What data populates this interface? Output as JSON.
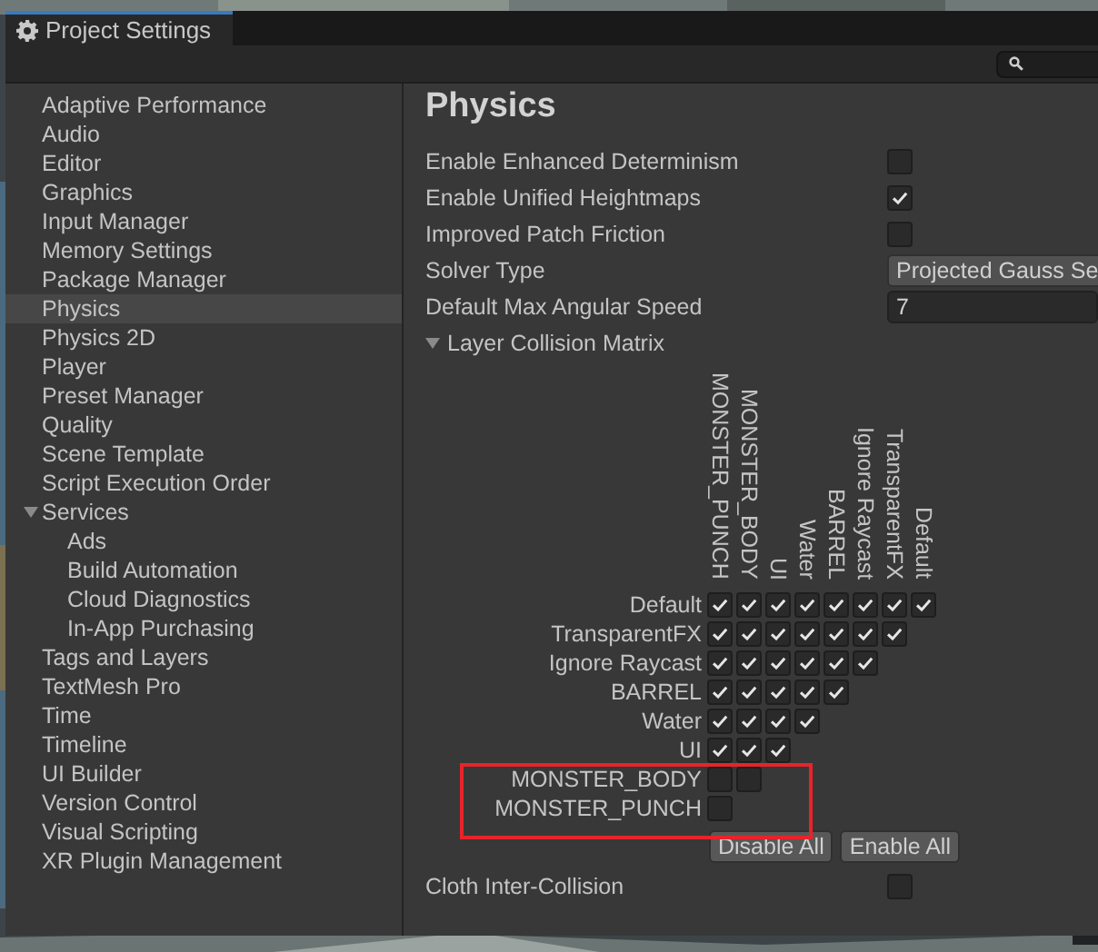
{
  "window": {
    "title": "Project Settings"
  },
  "sidebar": {
    "items": [
      {
        "label": "Adaptive Performance",
        "selected": false
      },
      {
        "label": "Audio",
        "selected": false
      },
      {
        "label": "Editor",
        "selected": false
      },
      {
        "label": "Graphics",
        "selected": false
      },
      {
        "label": "Input Manager",
        "selected": false
      },
      {
        "label": "Memory Settings",
        "selected": false
      },
      {
        "label": "Package Manager",
        "selected": false
      },
      {
        "label": "Physics",
        "selected": true
      },
      {
        "label": "Physics 2D",
        "selected": false
      },
      {
        "label": "Player",
        "selected": false
      },
      {
        "label": "Preset Manager",
        "selected": false
      },
      {
        "label": "Quality",
        "selected": false
      },
      {
        "label": "Scene Template",
        "selected": false
      },
      {
        "label": "Script Execution Order",
        "selected": false
      },
      {
        "label": "Services",
        "selected": false,
        "expanded": true,
        "children": [
          {
            "label": "Ads",
            "selected": false
          },
          {
            "label": "Build Automation",
            "selected": false
          },
          {
            "label": "Cloud Diagnostics",
            "selected": false
          },
          {
            "label": "In-App Purchasing",
            "selected": false
          }
        ]
      },
      {
        "label": "Tags and Layers",
        "selected": false
      },
      {
        "label": "TextMesh Pro",
        "selected": false
      },
      {
        "label": "Time",
        "selected": false
      },
      {
        "label": "Timeline",
        "selected": false
      },
      {
        "label": "UI Builder",
        "selected": false
      },
      {
        "label": "Version Control",
        "selected": false
      },
      {
        "label": "Visual Scripting",
        "selected": false
      },
      {
        "label": "XR Plugin Management",
        "selected": false
      }
    ]
  },
  "inspector": {
    "title": "Physics",
    "properties": [
      {
        "kind": "checkbox",
        "label": "Enable Enhanced Determinism",
        "checked": false
      },
      {
        "kind": "checkbox",
        "label": "Enable Unified Heightmaps",
        "checked": true
      },
      {
        "kind": "checkbox",
        "label": "Improved Patch Friction",
        "checked": false
      },
      {
        "kind": "dropdown",
        "label": "Solver Type",
        "value": "Projected Gauss Se"
      },
      {
        "kind": "number",
        "label": "Default Max Angular Speed",
        "value": "7"
      },
      {
        "kind": "foldout",
        "label": "Layer Collision Matrix",
        "expanded": true
      }
    ],
    "matrix": {
      "columns": [
        "MONSTER_PUNCH",
        "MONSTER_BODY",
        "UI",
        "Water",
        "BARREL",
        "Ignore Raycast",
        "TransparentFX",
        "Default"
      ],
      "rows": [
        {
          "label": "Default",
          "cells": [
            true,
            true,
            true,
            true,
            true,
            true,
            true,
            true
          ]
        },
        {
          "label": "TransparentFX",
          "cells": [
            true,
            true,
            true,
            true,
            true,
            true,
            true
          ]
        },
        {
          "label": "Ignore Raycast",
          "cells": [
            true,
            true,
            true,
            true,
            true,
            true
          ]
        },
        {
          "label": "BARREL",
          "cells": [
            true,
            true,
            true,
            true,
            true
          ]
        },
        {
          "label": "Water",
          "cells": [
            true,
            true,
            true,
            true
          ]
        },
        {
          "label": "UI",
          "cells": [
            true,
            true,
            true
          ]
        },
        {
          "label": "MONSTER_BODY",
          "cells": [
            false,
            false
          ]
        },
        {
          "label": "MONSTER_PUNCH",
          "cells": [
            false
          ]
        }
      ],
      "buttons": [
        "Disable All",
        "Enable All"
      ],
      "highlight": true
    },
    "after": [
      {
        "kind": "checkbox",
        "label": "Cloth Inter-Collision",
        "checked": false
      }
    ]
  }
}
